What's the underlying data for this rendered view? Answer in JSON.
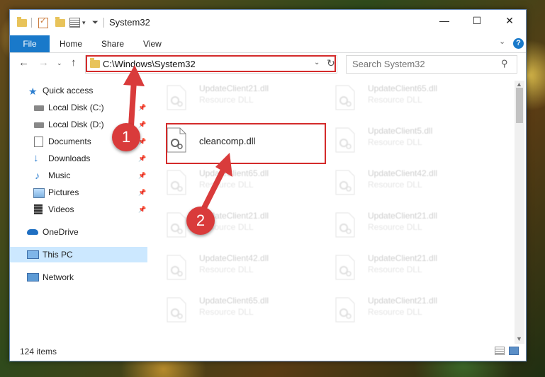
{
  "window": {
    "title": "System32",
    "controls": {
      "minimize": "—",
      "maximize": "☐",
      "close": "✕"
    }
  },
  "ribbon": {
    "tabs": [
      "File",
      "Home",
      "Share",
      "View"
    ],
    "collapse_icon": "chevron-down-icon",
    "help": "?"
  },
  "address_bar": {
    "path": "C:\\Windows\\System32",
    "search_placeholder": "Search System32"
  },
  "nav": {
    "items": [
      {
        "label": "Quick access",
        "icon": "star-icon"
      },
      {
        "label": "Local Disk (C:)",
        "icon": "drive-icon",
        "pinned": true
      },
      {
        "label": "Local Disk (D:)",
        "icon": "drive-icon",
        "pinned": true
      },
      {
        "label": "Documents",
        "icon": "documents-icon",
        "pinned": true
      },
      {
        "label": "Downloads",
        "icon": "download-icon",
        "pinned": true
      },
      {
        "label": "Music",
        "icon": "music-icon",
        "pinned": true
      },
      {
        "label": "Pictures",
        "icon": "pictures-icon",
        "pinned": true
      },
      {
        "label": "Videos",
        "icon": "videos-icon",
        "pinned": true
      },
      {
        "label": "OneDrive",
        "icon": "cloud-icon"
      },
      {
        "label": "This PC",
        "icon": "computer-icon",
        "selected": true
      },
      {
        "label": "Network",
        "icon": "network-icon"
      }
    ]
  },
  "files": [
    {
      "name": "UpdateClient21.dll",
      "type": "Resource DLL"
    },
    {
      "name": "UpdateClient65.dll",
      "type": "Resource DLL"
    },
    {
      "name": "cleancomp.dll",
      "type": ""
    },
    {
      "name": "UpdateClient5.dll",
      "type": "Resource DLL"
    },
    {
      "name": "UpdateClient65.dll",
      "type": "Resource DLL"
    },
    {
      "name": "UpdateClient42.dll",
      "type": "Resource DLL"
    },
    {
      "name": "UpdateClient21.dll",
      "type": "Resource DLL"
    },
    {
      "name": "UpdateClient21.dll",
      "type": "Resource DLL"
    },
    {
      "name": "UpdateClient42.dll",
      "type": "Resource DLL"
    },
    {
      "name": "UpdateClient21.dll",
      "type": "Resource DLL"
    },
    {
      "name": "UpdateClient65.dll",
      "type": "Resource DLL"
    },
    {
      "name": "UpdateClient21.dll",
      "type": "Resource DLL"
    }
  ],
  "status": {
    "item_count": "124 items"
  },
  "annotations": {
    "step1": "1",
    "step2": "2"
  },
  "colors": {
    "accent": "#1979ca",
    "annotation": "#d93b3b",
    "selected_bg": "#cce8ff"
  }
}
